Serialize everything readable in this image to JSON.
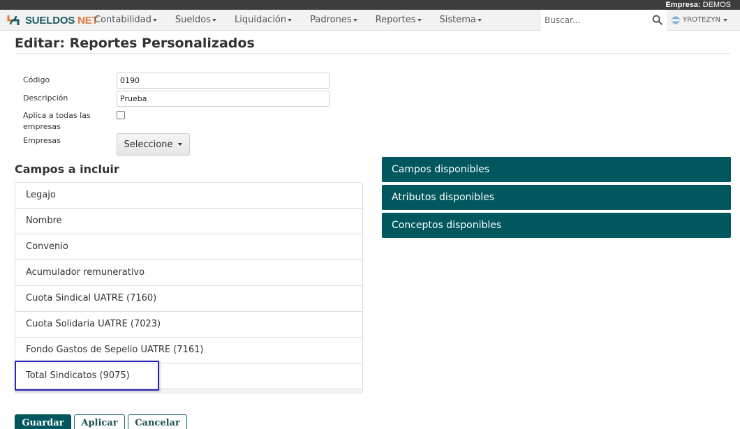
{
  "topbar": {
    "empresa_label": "Empresa:",
    "empresa_value": "DEMOS"
  },
  "brand": {
    "part1": "SUELDOS",
    "part2": "NET"
  },
  "menu": [
    {
      "label": "Contabilidad"
    },
    {
      "label": "Sueldos"
    },
    {
      "label": "Liquidación"
    },
    {
      "label": "Padrones"
    },
    {
      "label": "Reportes"
    },
    {
      "label": "Sistema"
    }
  ],
  "search": {
    "placeholder": "Buscar..."
  },
  "user": {
    "name": "YROTEZYN"
  },
  "page": {
    "title": "Editar: Reportes Personalizados"
  },
  "form": {
    "codigo_label": "Código",
    "codigo_value": "0190",
    "descripcion_label": "Descripción",
    "descripcion_value": "Prueba",
    "aplica_label_line1": "Aplica a todas las",
    "aplica_label_line2": "empresas",
    "aplica_checked": false,
    "empresas_label": "Empresas",
    "empresas_select": "Seleccione"
  },
  "campos": {
    "title": "Campos a incluir",
    "items": [
      "Legajo",
      "Nombre",
      "Convenio",
      "Acumulador remunerativo",
      "Cuota Sindical UATRE (7160)",
      "Cuota Solidaria UATRE (7023)",
      "Fondo Gastos de Sepelio UATRE (7161)",
      "Total Sindicatos (9075)"
    ]
  },
  "panels": [
    {
      "label": "Campos disponibles"
    },
    {
      "label": "Atributos disponibles"
    },
    {
      "label": "Conceptos disponibles"
    }
  ],
  "actions": {
    "save": "Guardar",
    "apply": "Aplicar",
    "cancel": "Cancelar"
  },
  "colors": {
    "accent": "#00575d",
    "brand_orange": "#e0793b",
    "highlight": "#2525b8"
  }
}
